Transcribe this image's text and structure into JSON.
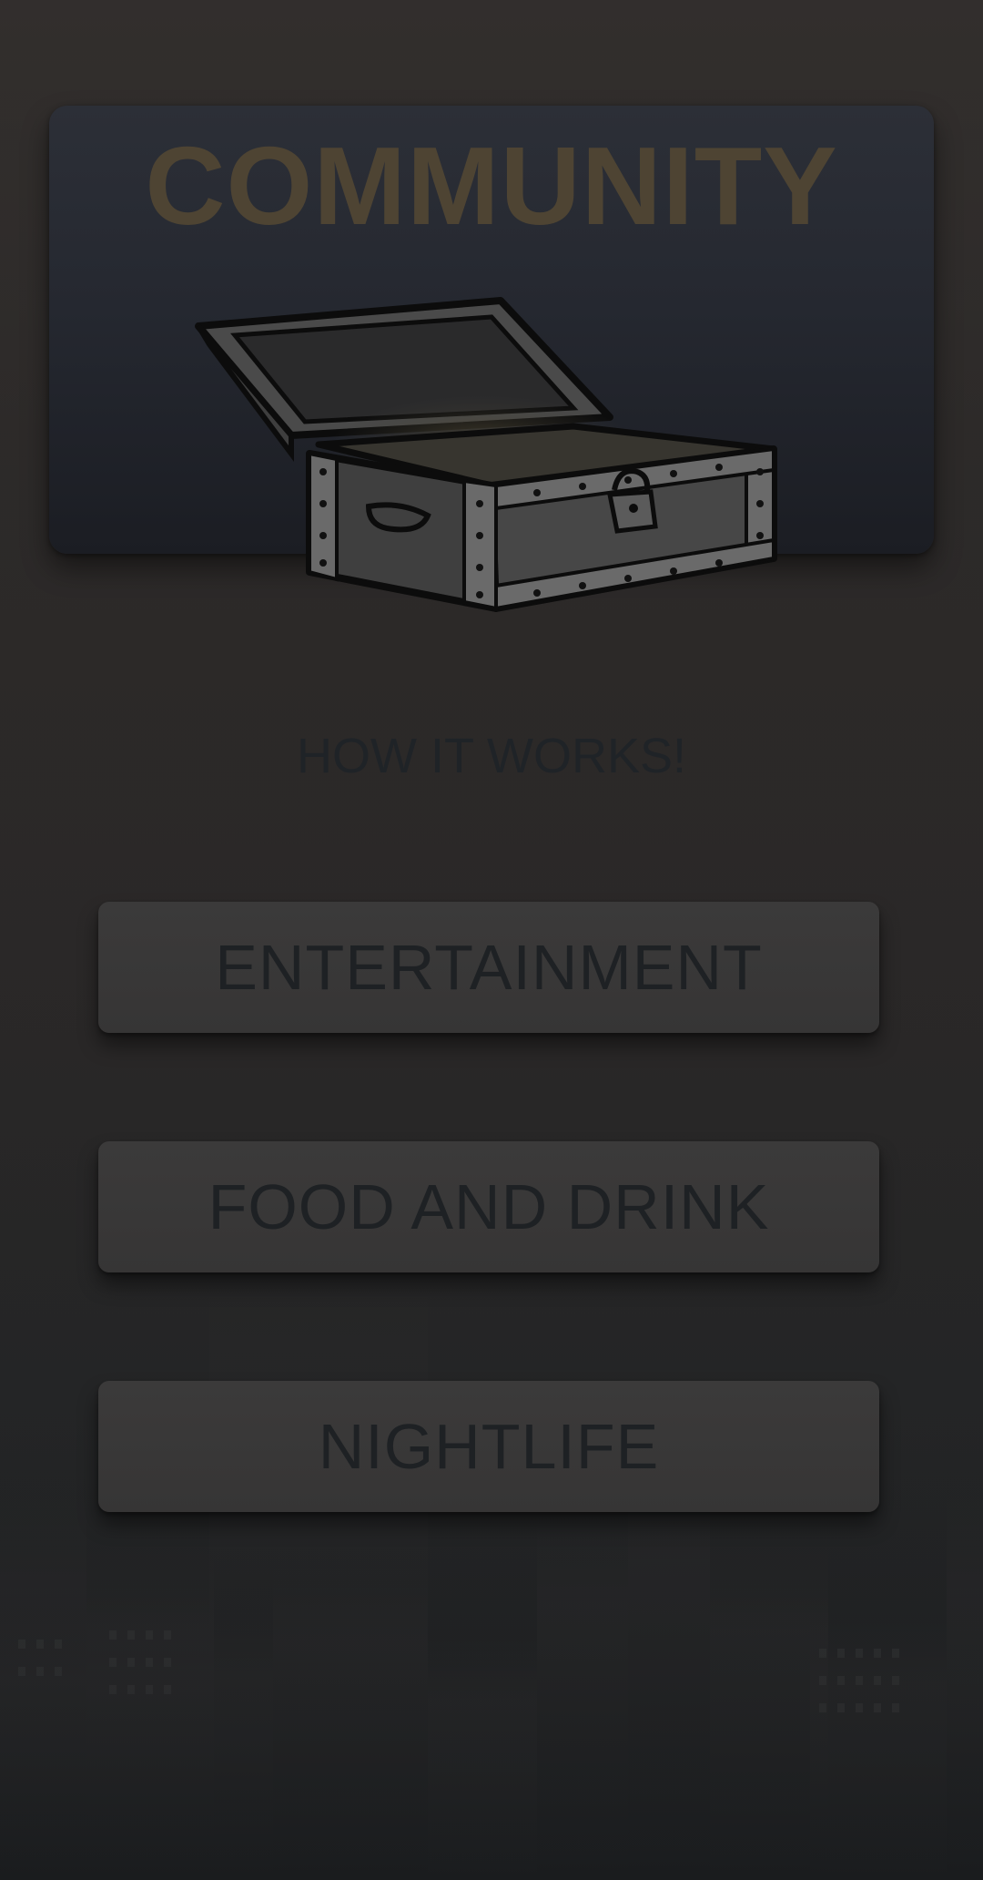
{
  "hero": {
    "title": "COMMUNITY",
    "image_icon": "treasure-chest-icon"
  },
  "how_it_works": "HOW IT WORKS!",
  "categories": [
    {
      "label": "ENTERTAINMENT"
    },
    {
      "label": "FOOD AND DRINK"
    },
    {
      "label": "NIGHTLIFE"
    }
  ],
  "colors": {
    "title": "#4e4433",
    "button_text": "#1e2124",
    "card": "#262930"
  }
}
